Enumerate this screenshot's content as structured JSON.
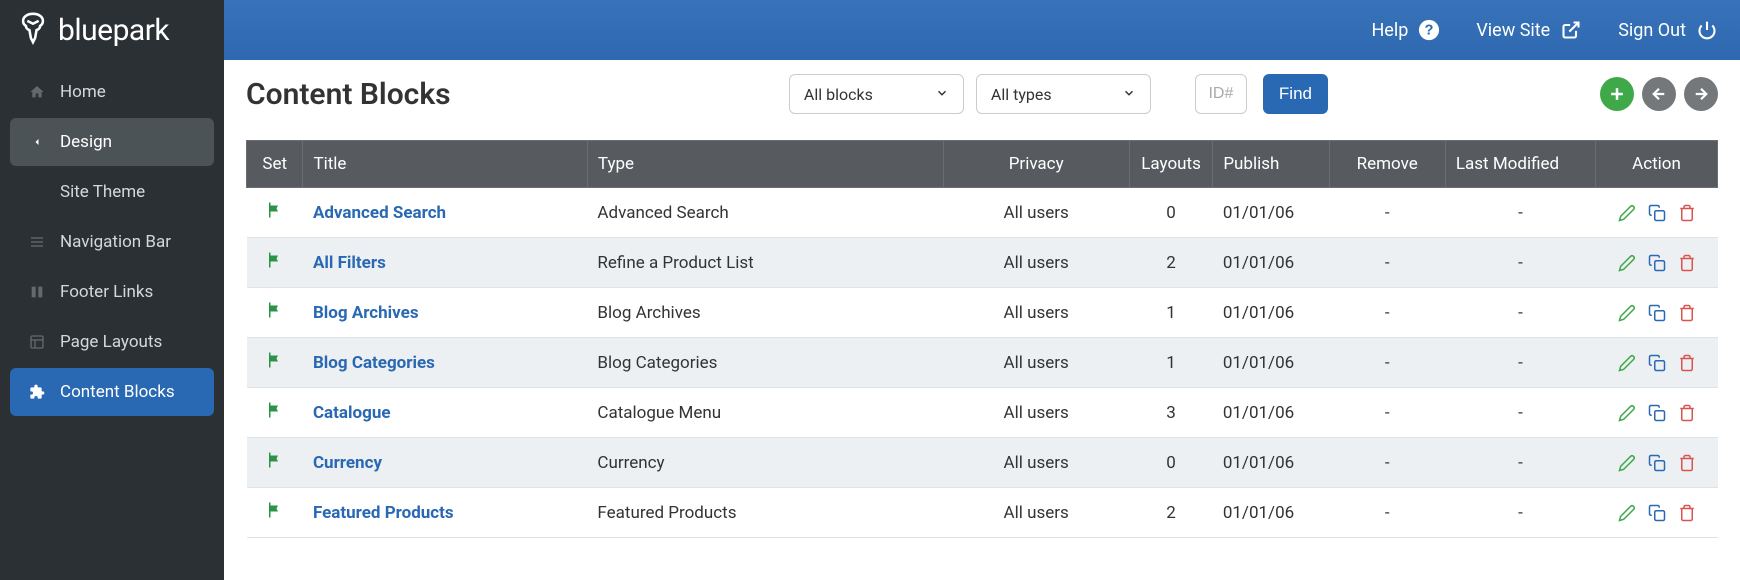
{
  "brand": "bluepark",
  "topbar": {
    "help": "Help",
    "view_site": "View Site",
    "sign_out": "Sign Out"
  },
  "sidebar": {
    "items": [
      {
        "label": "Home",
        "icon": "home"
      },
      {
        "label": "Design",
        "icon": "chevron-left",
        "active_section": true
      },
      {
        "label": "Site Theme",
        "icon": "blank"
      },
      {
        "label": "Navigation Bar",
        "icon": "list"
      },
      {
        "label": "Footer Links",
        "icon": "columns"
      },
      {
        "label": "Page Layouts",
        "icon": "layout"
      },
      {
        "label": "Content Blocks",
        "icon": "puzzle",
        "active_page": true
      }
    ]
  },
  "page": {
    "title": "Content Blocks",
    "filter_select": "All blocks",
    "type_select": "All types",
    "id_placeholder": "ID#",
    "find_label": "Find"
  },
  "table": {
    "headers": {
      "set": "Set",
      "title": "Title",
      "type": "Type",
      "privacy": "Privacy",
      "layouts": "Layouts",
      "publish": "Publish",
      "remove": "Remove",
      "modified": "Last Modified",
      "action": "Action"
    },
    "rows": [
      {
        "title": "Advanced Search",
        "type": "Advanced Search",
        "privacy": "All users",
        "layouts": "0",
        "publish": "01/01/06",
        "remove": "-",
        "modified": "-"
      },
      {
        "title": "All Filters",
        "type": "Refine a Product List",
        "privacy": "All users",
        "layouts": "2",
        "publish": "01/01/06",
        "remove": "-",
        "modified": "-"
      },
      {
        "title": "Blog Archives",
        "type": "Blog Archives",
        "privacy": "All users",
        "layouts": "1",
        "publish": "01/01/06",
        "remove": "-",
        "modified": "-"
      },
      {
        "title": "Blog Categories",
        "type": "Blog Categories",
        "privacy": "All users",
        "layouts": "1",
        "publish": "01/01/06",
        "remove": "-",
        "modified": "-"
      },
      {
        "title": "Catalogue",
        "type": "Catalogue Menu",
        "privacy": "All users",
        "layouts": "3",
        "publish": "01/01/06",
        "remove": "-",
        "modified": "-"
      },
      {
        "title": "Currency",
        "type": "Currency",
        "privacy": "All users",
        "layouts": "0",
        "publish": "01/01/06",
        "remove": "-",
        "modified": "-"
      },
      {
        "title": "Featured Products",
        "type": "Featured Products",
        "privacy": "All users",
        "layouts": "2",
        "publish": "01/01/06",
        "remove": "-",
        "modified": "-"
      }
    ]
  }
}
